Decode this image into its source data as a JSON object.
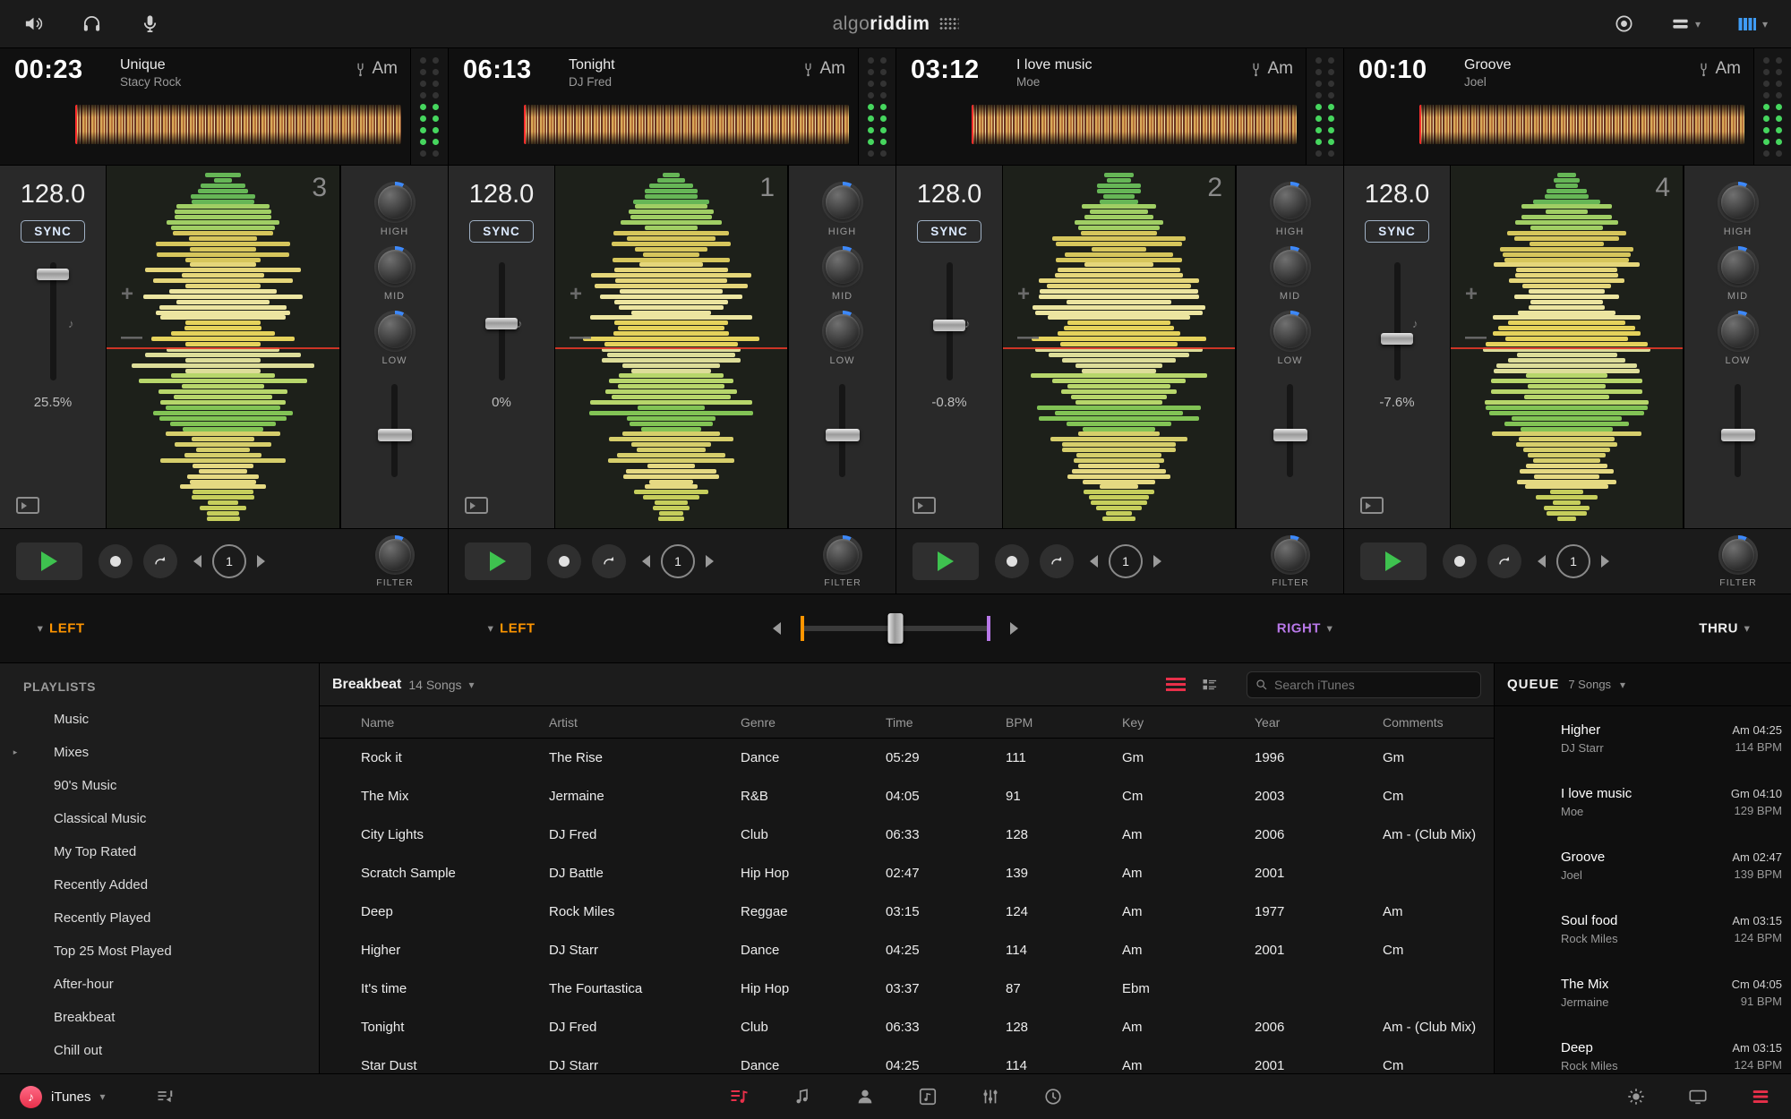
{
  "colors": {
    "accent_orange": "#ff9500",
    "accent_purple": "#b878e8",
    "accent_blue": "#3f8cff",
    "accent_green": "#3ec24f",
    "accent_red": "#ff2d55"
  },
  "icons": {
    "caret_down": "▾",
    "check": "✓",
    "expander": "▸",
    "note": "♪"
  },
  "topbar": {
    "logo_algo": "algo",
    "logo_riddim": "riddim"
  },
  "decks": [
    {
      "number": "3",
      "time": "00:23",
      "title": "Unique",
      "artist": "Stacy Rock",
      "key": "Am",
      "bpm": "128.0",
      "sync_label": "SYNC",
      "pitch": "25.5%",
      "eq_high": "HIGH",
      "eq_mid": "MID",
      "eq_low": "LOW",
      "filter_label": "FILTER",
      "loop_value": "1",
      "wave": "w3",
      "art": "crowd"
    },
    {
      "number": "1",
      "time": "06:13",
      "title": "Tonight",
      "artist": "DJ Fred",
      "key": "Am",
      "bpm": "128.0",
      "sync_label": "SYNC",
      "pitch": "0%",
      "eq_high": "HIGH",
      "eq_mid": "MID",
      "eq_low": "LOW",
      "filter_label": "FILTER",
      "loop_value": "1",
      "wave": "w1",
      "art": "painting"
    },
    {
      "number": "2",
      "time": "03:12",
      "title": "I love music",
      "artist": "Moe",
      "key": "Am",
      "bpm": "128.0",
      "sync_label": "SYNC",
      "pitch": "-0.8%",
      "eq_high": "HIGH",
      "eq_mid": "MID",
      "eq_low": "LOW",
      "filter_label": "FILTER",
      "loop_value": "1",
      "wave": "w2",
      "art": "palms"
    },
    {
      "number": "4",
      "time": "00:10",
      "title": "Groove",
      "artist": "Joel",
      "key": "Am",
      "bpm": "128.0",
      "sync_label": "SYNC",
      "pitch": "-7.6%",
      "eq_high": "HIGH",
      "eq_mid": "MID",
      "eq_low": "LOW",
      "filter_label": "FILTER",
      "loop_value": "1",
      "wave": "w4",
      "art": "blueswirl"
    }
  ],
  "crossfader": {
    "left_a": "LEFT",
    "left_b": "LEFT",
    "right": "RIGHT",
    "thru": "THRU"
  },
  "sidebar": {
    "title": "PLAYLISTS",
    "items": [
      {
        "label": "Music",
        "icon": "playlist"
      },
      {
        "label": "Mixes",
        "icon": "playlist",
        "expander": "▸"
      },
      {
        "label": "90's Music",
        "icon": "smart"
      },
      {
        "label": "Classical Music",
        "icon": "smart"
      },
      {
        "label": "My Top Rated",
        "icon": "smart"
      },
      {
        "label": "Recently Added",
        "icon": "smart"
      },
      {
        "label": "Recently Played",
        "icon": "smart"
      },
      {
        "label": "Top 25 Most Played",
        "icon": "smart"
      },
      {
        "label": "After-hour",
        "icon": "playlist"
      },
      {
        "label": "Breakbeat",
        "icon": "playlist",
        "selected": "selected"
      },
      {
        "label": "Chill out",
        "icon": "playlist"
      }
    ]
  },
  "library": {
    "playlist_name": "Breakbeat",
    "song_count": "14 Songs",
    "search_placeholder": "Search iTunes",
    "columns": [
      "Name",
      "Artist",
      "Genre",
      "Time",
      "BPM",
      "Key",
      "Year",
      "Comments"
    ],
    "rows": [
      {
        "icon": "",
        "name": "Rock it",
        "artist": "The Rise",
        "genre": "Dance",
        "time": "05:29",
        "bpm": "111",
        "key": "Gm",
        "year": "1996",
        "comments": "Gm",
        "state": ""
      },
      {
        "icon": "queue",
        "name": "The Mix",
        "artist": "Jermaine",
        "genre": "R&B",
        "time": "04:05",
        "bpm": "91",
        "key": "Cm",
        "year": "2003",
        "comments": "Cm",
        "state": "selected"
      },
      {
        "icon": "",
        "name": "City Lights",
        "artist": "DJ Fred",
        "genre": "Club",
        "time": "06:33",
        "bpm": "128",
        "key": "Am",
        "year": "2006",
        "comments": "Am - (Club Mix)",
        "state": ""
      },
      {
        "icon": "check",
        "name": "Scratch Sample",
        "artist": "DJ Battle",
        "genre": "Hip Hop",
        "time": "02:47",
        "bpm": "139",
        "key": "Am",
        "year": "2001",
        "comments": "",
        "state": ""
      },
      {
        "icon": "queue",
        "name": "Deep",
        "artist": "Rock Miles",
        "genre": "Reggae",
        "time": "03:15",
        "bpm": "124",
        "key": "Am",
        "year": "1977",
        "comments": "Am",
        "state": ""
      },
      {
        "icon": "queue",
        "name": "Higher",
        "artist": "DJ Starr",
        "genre": "Dance",
        "time": "04:25",
        "bpm": "114",
        "key": "Am",
        "year": "2001",
        "comments": "Cm",
        "state": ""
      },
      {
        "icon": "queue",
        "name": "It's time",
        "artist": "The Fourtastica",
        "genre": "Hip Hop",
        "time": "03:37",
        "bpm": "87",
        "key": "Ebm",
        "year": "",
        "comments": "",
        "state": ""
      },
      {
        "icon": "check",
        "name": "Tonight",
        "artist": "DJ Fred",
        "genre": "Club",
        "time": "06:33",
        "bpm": "128",
        "key": "Am",
        "year": "2006",
        "comments": "Am - (Club Mix)",
        "state": ""
      },
      {
        "icon": "check",
        "name": "Star Dust",
        "artist": "DJ Starr",
        "genre": "Dance",
        "time": "04:25",
        "bpm": "114",
        "key": "Am",
        "year": "2001",
        "comments": "Cm",
        "state": ""
      }
    ]
  },
  "queue": {
    "title": "QUEUE",
    "count": "7 Songs",
    "items": [
      {
        "title": "Higher",
        "artist": "DJ Starr",
        "key_time": "Am 04:25",
        "bpm": "114 BPM",
        "check": "",
        "art": "mosaic"
      },
      {
        "title": "I love music",
        "artist": "Moe",
        "key_time": "Gm 04:10",
        "bpm": "129 BPM",
        "check": "check",
        "art": "palms"
      },
      {
        "title": "Groove",
        "artist": "Joel",
        "key_time": "Am 02:47",
        "bpm": "139 BPM",
        "check": "check",
        "art": "blueswirl"
      },
      {
        "title": "Soul food",
        "artist": "Rock Miles",
        "key_time": "Am 03:15",
        "bpm": "124 BPM",
        "check": "check",
        "art": "prism"
      },
      {
        "title": "The Mix",
        "artist": "Jermaine",
        "key_time": "Cm 04:05",
        "bpm": "91 BPM",
        "check": "check",
        "art": "crowd"
      },
      {
        "title": "Deep",
        "artist": "Rock Miles",
        "key_time": "Am 03:15",
        "bpm": "124 BPM",
        "check": "check",
        "art": "prism"
      }
    ]
  },
  "footer": {
    "source": "iTunes"
  }
}
